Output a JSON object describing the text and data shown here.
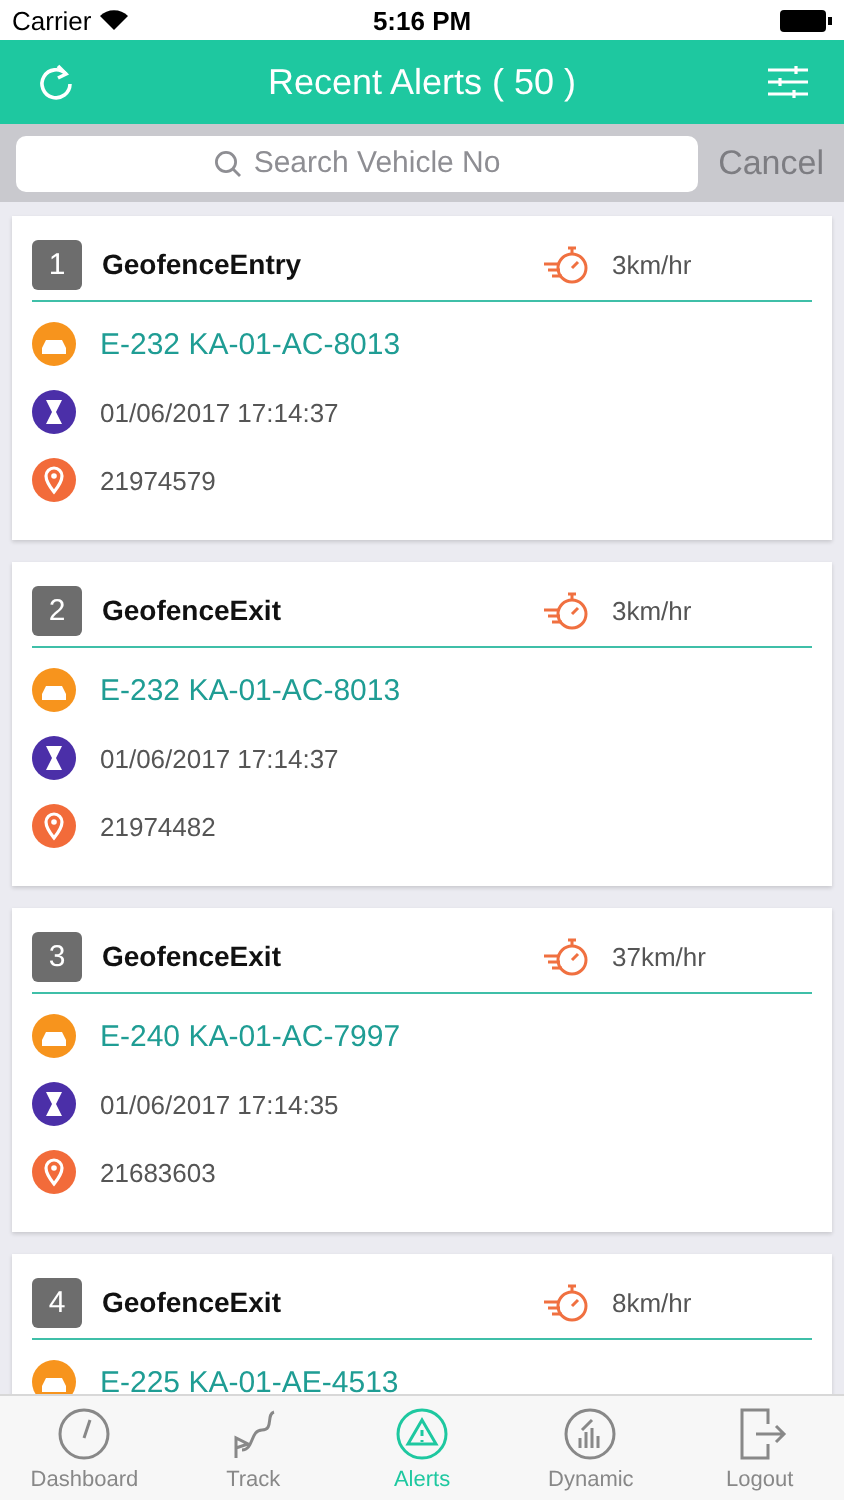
{
  "status_bar": {
    "carrier": "Carrier",
    "time": "5:16 PM"
  },
  "header": {
    "title": "Recent Alerts ( 50 )"
  },
  "search": {
    "placeholder": "Search Vehicle No",
    "cancel": "Cancel"
  },
  "alerts": [
    {
      "number": "1",
      "type": "GeofenceEntry",
      "speed": "3km/hr",
      "vehicle": "E-232 KA-01-AC-8013",
      "datetime": "01/06/2017 17:14:37",
      "location": "21974579"
    },
    {
      "number": "2",
      "type": "GeofenceExit",
      "speed": "3km/hr",
      "vehicle": "E-232 KA-01-AC-8013",
      "datetime": "01/06/2017 17:14:37",
      "location": "21974482"
    },
    {
      "number": "3",
      "type": "GeofenceExit",
      "speed": "37km/hr",
      "vehicle": "E-240 KA-01-AC-7997",
      "datetime": "01/06/2017 17:14:35",
      "location": "21683603"
    },
    {
      "number": "4",
      "type": "GeofenceExit",
      "speed": "8km/hr",
      "vehicle": "E-225 KA-01-AE-4513"
    }
  ],
  "tabs": [
    {
      "label": "Dashboard",
      "kind": "gauge",
      "selected": false
    },
    {
      "label": "Track",
      "kind": "route",
      "selected": false
    },
    {
      "label": "Alerts",
      "kind": "warning",
      "selected": true
    },
    {
      "label": "Dynamic",
      "kind": "chart",
      "selected": false
    },
    {
      "label": "Logout",
      "kind": "exit",
      "selected": false
    }
  ]
}
